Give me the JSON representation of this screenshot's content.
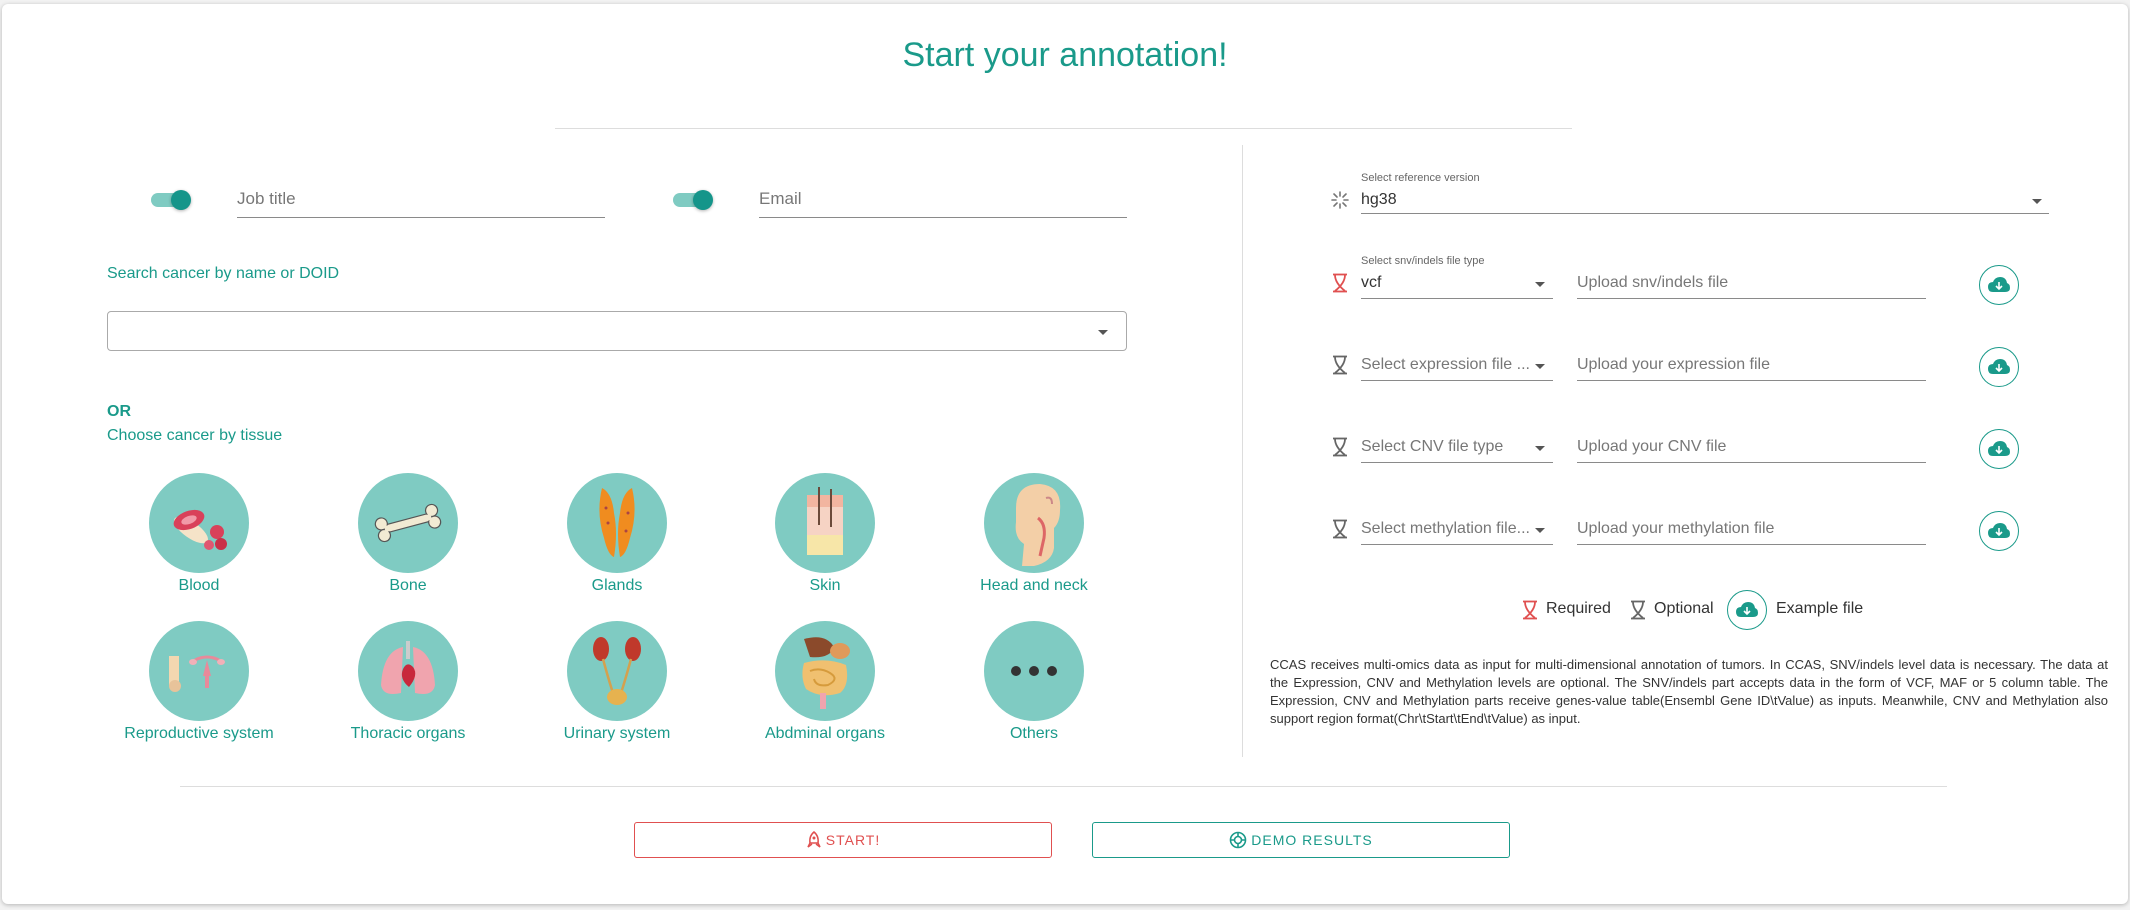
{
  "title": "Start your annotation!",
  "job": {
    "placeholder": "Job title"
  },
  "email": {
    "placeholder": "Email"
  },
  "search": {
    "label": "Search cancer by name or DOID",
    "value": ""
  },
  "or_text": "OR",
  "tissue_label": "Choose cancer by tissue",
  "tissues": [
    {
      "label": "Blood"
    },
    {
      "label": "Bone"
    },
    {
      "label": "Glands"
    },
    {
      "label": "Skin"
    },
    {
      "label": "Head and neck"
    },
    {
      "label": "Reproductive system"
    },
    {
      "label": "Thoracic organs"
    },
    {
      "label": "Urinary system"
    },
    {
      "label": "Abdminal organs"
    },
    {
      "label": "Others"
    }
  ],
  "reference": {
    "label": "Select reference version",
    "value": "hg38"
  },
  "files": [
    {
      "type_label": "Select snv/indels file type",
      "type_value": "vcf",
      "upload_placeholder": "Upload snv/indels file",
      "required": true
    },
    {
      "type_placeholder": "Select expression file ...",
      "upload_placeholder": "Upload your expression file",
      "required": false
    },
    {
      "type_placeholder": "Select CNV file type",
      "upload_placeholder": "Upload your CNV file",
      "required": false
    },
    {
      "type_placeholder": "Select methylation file...",
      "upload_placeholder": "Upload your methylation file",
      "required": false
    }
  ],
  "legend": {
    "required": "Required",
    "optional": "Optional",
    "example": "Example file"
  },
  "description": "CCAS receives multi-omics data as input for multi-dimensional annotation of tumors. In CCAS, SNV/indels level data is necessary. The data at the Expression, CNV and Methylation levels are optional. The SNV/indels part accepts data in the form of VCF, MAF or 5 column table. The Expression, CNV and Methylation parts receive genes-value table(Ensembl Gene ID\\tValue) as inputs. Meanwhile, CNV and Methylation also support region format(Chr\\tStart\\tEnd\\tValue) as input.",
  "buttons": {
    "start": "START!",
    "demo": "DEMO RESULTS"
  },
  "colors": {
    "accent": "#1a9a8a",
    "tissue_bg": "#7fcbc2",
    "required": "#e05050"
  }
}
